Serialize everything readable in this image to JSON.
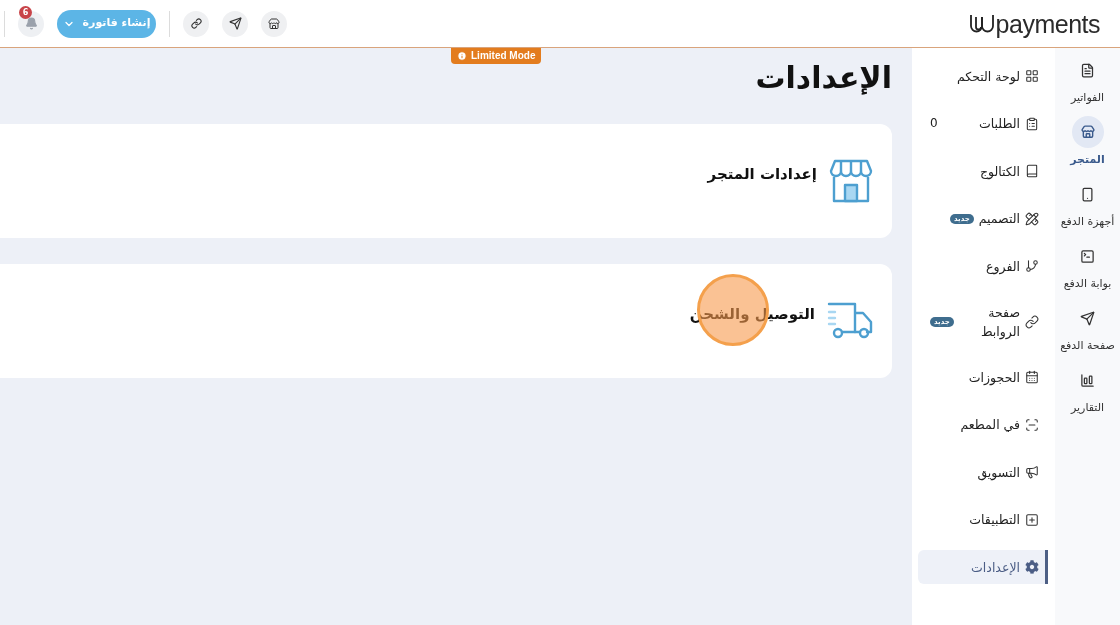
{
  "header": {
    "logo": "payments",
    "notification_count": "6",
    "create_invoice_button": "إنشاء فاتورة"
  },
  "limited_mode_badge": "Limited Mode",
  "page_title": "الإعدادات",
  "cards": [
    {
      "kind": "store",
      "title": "إعدادات المتجر"
    },
    {
      "kind": "truck",
      "title": "التوصيل والشحن"
    }
  ],
  "rail": {
    "items": [
      {
        "label": "الفواتير",
        "selected": false
      },
      {
        "label": "المتجر",
        "selected": true
      },
      {
        "label": "أجهزة الدفع",
        "selected": false
      },
      {
        "label": "بوابة الدفع",
        "selected": false
      },
      {
        "label": "صفحة الدفع",
        "selected": false
      },
      {
        "label": "التقارير",
        "selected": false
      }
    ]
  },
  "nav": {
    "items": [
      {
        "label": "لوحة التحكم",
        "selected": false
      },
      {
        "label": "الطلبات",
        "count": "0",
        "selected": false
      },
      {
        "label": "الكتالوج",
        "selected": false
      },
      {
        "label": "التصميم",
        "badge": "جديد",
        "selected": false
      },
      {
        "label": "الفروع",
        "selected": false
      },
      {
        "label": "صفحة الروابط",
        "badge": "جديد",
        "selected": false
      },
      {
        "label": "الحجوزات",
        "selected": false
      },
      {
        "label": "في المطعم",
        "selected": false
      },
      {
        "label": "التسويق",
        "selected": false
      },
      {
        "label": "التطبيقات",
        "selected": false
      },
      {
        "label": "الإعدادات",
        "selected": true
      }
    ]
  }
}
